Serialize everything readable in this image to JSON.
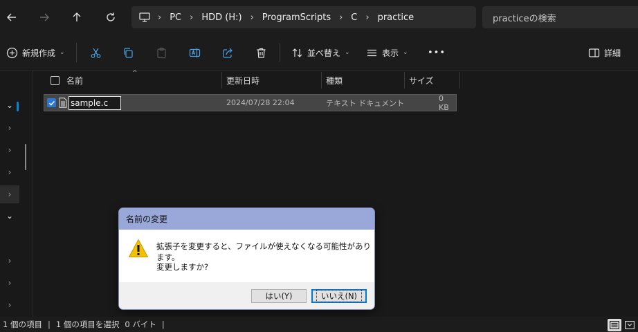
{
  "nav": {
    "breadcrumbs": [
      "PC",
      "HDD (H:)",
      "ProgramScripts",
      "C",
      "practice"
    ],
    "search_placeholder": "practiceの検索"
  },
  "toolbar": {
    "new_label": "新規作成",
    "sort_label": "並べ替え",
    "view_label": "表示",
    "more_label": "•••",
    "details_label": "詳細"
  },
  "columns": {
    "name": "名前",
    "modified": "更新日時",
    "type": "種類",
    "size": "サイズ"
  },
  "files": [
    {
      "name": "sample.c",
      "modified": "2024/07/28 22:04",
      "type": "テキスト ドキュメント",
      "size": "0 KB",
      "selected": true,
      "renaming": true
    }
  ],
  "dialog": {
    "title": "名前の変更",
    "message": "拡張子を変更すると、ファイルが使えなくなる可能性があります。",
    "question": "変更しますか?",
    "yes_label": "はい(Y)",
    "no_label": "いいえ(N)"
  },
  "status": {
    "item_count": "1 個の項目",
    "selected": "1 個の項目を選択",
    "size": "0 バイト"
  },
  "colors": {
    "accent": "#0a84d6",
    "dialog_title_bg": "#99a8d8",
    "warning": "#f2c200"
  }
}
